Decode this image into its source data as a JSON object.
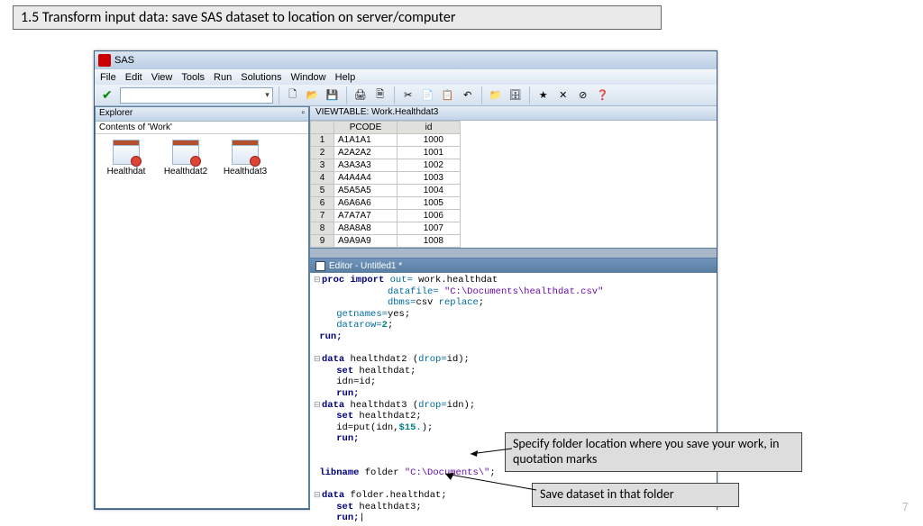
{
  "slide": {
    "title": "1.5 Transform input data: save SAS dataset to location on server/computer",
    "page": "7"
  },
  "app": {
    "title": "SAS",
    "menus": [
      "File",
      "Edit",
      "View",
      "Tools",
      "Run",
      "Solutions",
      "Window",
      "Help"
    ]
  },
  "explorer": {
    "title": "Explorer",
    "subtitle": "Contents of 'Work'",
    "items": [
      "Healthdat",
      "Healthdat2",
      "Healthdat3"
    ]
  },
  "viewtable": {
    "title": "VIEWTABLE: Work.Healthdat3",
    "cols": [
      "",
      "PCODE",
      "id"
    ],
    "rows": [
      [
        "1",
        "A1A1A1",
        "1000"
      ],
      [
        "2",
        "A2A2A2",
        "1001"
      ],
      [
        "3",
        "A3A3A3",
        "1002"
      ],
      [
        "4",
        "A4A4A4",
        "1003"
      ],
      [
        "5",
        "A5A5A5",
        "1004"
      ],
      [
        "6",
        "A6A6A6",
        "1005"
      ],
      [
        "7",
        "A7A7A7",
        "1006"
      ],
      [
        "8",
        "A8A8A8",
        "1007"
      ],
      [
        "9",
        "A9A9A9",
        "1008"
      ]
    ]
  },
  "editor": {
    "title": "Editor - Untitled1 *",
    "code": {
      "l1a": "proc import ",
      "l1b": "out=",
      "l1c": " work.healthdat",
      "l2a": "            ",
      "l2b": "datafile=",
      "l2c": " \"C:\\Documents\\healthdat.csv\"",
      "l3a": "            ",
      "l3b": "dbms=",
      "l3c": "csv ",
      "l3d": "replace",
      "l4a": "   ",
      "l4b": "getnames=",
      "l4c": "yes;",
      "l5a": "   ",
      "l5b": "datarow=",
      "l5c": "2",
      "l6": "run;",
      "l7a": "data",
      " ": " ",
      "l7b": " healthdat2 (",
      "l7c": "drop=",
      "l7d": "id);",
      "l8a": "   ",
      "l8b": "set",
      "l8c": " healthdat;",
      "l9": "   idn=id;",
      "l10": "   run;",
      "l11a": "data",
      "l11b": " healthdat3 (",
      "l11c": "drop=",
      "l11d": "idn);",
      "l12a": "   ",
      "l12b": "set",
      "l12c": " healthdat2;",
      "l13a": "   id=put(idn,",
      "l13b": "$15.",
      "l13c": ");",
      "l14": "   run;",
      "l15a": "libname",
      "l15b": " folder ",
      "l15c": "\"C:\\Documents\\\"",
      "l16a": "data",
      "l16b": " folder.healthdat;",
      "l17a": "   ",
      "l17b": "set",
      "l17c": " healthdat3;",
      "l18": "   run;"
    }
  },
  "callouts": {
    "c1": "Specify folder location where you save your work, in quotation marks",
    "c2": "Save dataset in that folder"
  }
}
